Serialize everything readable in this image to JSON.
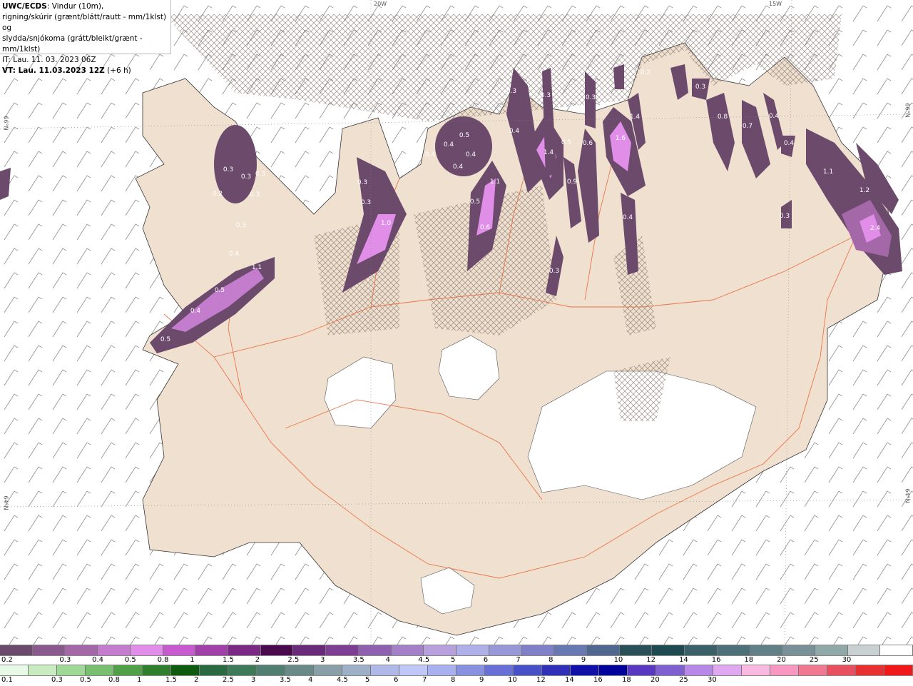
{
  "info": {
    "line1_bold": "UWC/ECDS",
    "line1_rest": ": Vindur (10m),",
    "line2": "rigning/skúrir (grænt/blátt/rautt - mm/1klst) og",
    "line3": "slydda/snjókoma (grátt/bleikt/grænt - mm/1klst)",
    "line4": "IT: Lau. 11. 03. 2023 06Z",
    "line5_bold": "VT: Lau. 11.03.2023 12Z",
    "line5_rest": " (+6 h)"
  },
  "grid_labels": {
    "lat_66": "66°N",
    "lat_64": "64°N",
    "lat_64_right": "64°N",
    "lat_66_right": "66°N",
    "lon_20w": "20W",
    "lon_15w": "15W"
  },
  "precip_values": [
    {
      "id": "v1",
      "text": "0.3"
    },
    {
      "id": "v2",
      "text": "0.3"
    },
    {
      "id": "v3",
      "text": "0.3"
    },
    {
      "id": "v4",
      "text": "0.2"
    },
    {
      "id": "v5",
      "text": "0.3"
    },
    {
      "id": "v6",
      "text": "0.3"
    },
    {
      "id": "v7",
      "text": "0.4"
    },
    {
      "id": "v8",
      "text": "1.1"
    },
    {
      "id": "v9",
      "text": "0.5"
    },
    {
      "id": "v10",
      "text": "0.4"
    },
    {
      "id": "v11",
      "text": "0.5"
    },
    {
      "id": "v12",
      "text": "0.3"
    },
    {
      "id": "v13",
      "text": "0.3"
    },
    {
      "id": "v14",
      "text": "1.0"
    },
    {
      "id": "v15",
      "text": "0.5"
    },
    {
      "id": "v16",
      "text": "0.4"
    },
    {
      "id": "v17",
      "text": "0.4"
    },
    {
      "id": "v18",
      "text": "0.4"
    },
    {
      "id": "v19",
      "text": "0.4"
    },
    {
      "id": "v20",
      "text": "1.1"
    },
    {
      "id": "v21",
      "text": "0.5"
    },
    {
      "id": "v22",
      "text": "0.6"
    },
    {
      "id": "v23",
      "text": "0.3"
    },
    {
      "id": "v24",
      "text": "0.4"
    },
    {
      "id": "v25",
      "text": "0.3"
    },
    {
      "id": "v26",
      "text": "1.4"
    },
    {
      "id": "v27",
      "text": "0.9"
    },
    {
      "id": "v28",
      "text": "0.6"
    },
    {
      "id": "v29",
      "text": "0.3"
    },
    {
      "id": "v30",
      "text": "0.3"
    },
    {
      "id": "v31",
      "text": "1.6"
    },
    {
      "id": "v32",
      "text": "1.4"
    },
    {
      "id": "v33",
      "text": "0.4"
    },
    {
      "id": "v34",
      "text": "0.2"
    },
    {
      "id": "v35",
      "text": "0.3"
    },
    {
      "id": "v36",
      "text": "0.8"
    },
    {
      "id": "v37",
      "text": "0.7"
    },
    {
      "id": "v38",
      "text": "0.4"
    },
    {
      "id": "v39",
      "text": "0.4"
    },
    {
      "id": "v40",
      "text": "0.3"
    },
    {
      "id": "v41",
      "text": "1.1"
    },
    {
      "id": "v42",
      "text": "1.2"
    },
    {
      "id": "v43",
      "text": "2.4"
    },
    {
      "id": "v44",
      "text": "0.5"
    }
  ],
  "snow_scale": {
    "colors": [
      "#6b4a6b",
      "#8a5a8e",
      "#a468a8",
      "#c47ccc",
      "#e08ee8",
      "#c85ad0",
      "#a040a8",
      "#7a2a84",
      "#4a0a4e",
      "#6a2a7a",
      "#7e3e94",
      "#9060b0",
      "#a480c8",
      "#b8a0dc",
      "#b0b0e8",
      "#9898d8",
      "#8080c8",
      "#6878b0",
      "#506890",
      "#2a5058",
      "#1e4a52",
      "#3a6068",
      "#4e7078",
      "#628088",
      "#7a9098",
      "#90a8a8",
      "#c8d0d0",
      "#ffffff"
    ],
    "labels": [
      "0.2",
      "0.3",
      "0.4",
      "0.5",
      "0.8",
      "1",
      "1.5",
      "2",
      "2.5",
      "3",
      "3.5",
      "4",
      "4.5",
      "5",
      "6",
      "7",
      "8",
      "9",
      "10",
      "12",
      "14",
      "16",
      "18",
      "20",
      "25",
      "30"
    ]
  },
  "rain_scale": {
    "colors": [
      "#e6fae6",
      "#c8ecc0",
      "#a0d898",
      "#78c070",
      "#50a048",
      "#2e7e2e",
      "#0e5a0e",
      "#2a6a40",
      "#3e7a58",
      "#507e70",
      "#6a8a88",
      "#8aa0a8",
      "#9eb0c8",
      "#b0b8e8",
      "#c0c8f8",
      "#a8b0f0",
      "#8890e0",
      "#6870d8",
      "#4850c8",
      "#3030b8",
      "#1010a8",
      "#00009a",
      "#5838c0",
      "#8060d0",
      "#b888e8",
      "#e0a8f0",
      "#f8b8e0",
      "#f898c0",
      "#f07890",
      "#e85060",
      "#e83030",
      "#f01818"
    ],
    "labels": [
      "0.1",
      "0.3",
      "0.5",
      "0.8",
      "1",
      "1.5",
      "2",
      "2.5",
      "3",
      "3.5",
      "4",
      "4.5",
      "5",
      "6",
      "7",
      "8",
      "9",
      "10",
      "12",
      "14",
      "16",
      "18",
      "20",
      "25",
      "30"
    ]
  }
}
